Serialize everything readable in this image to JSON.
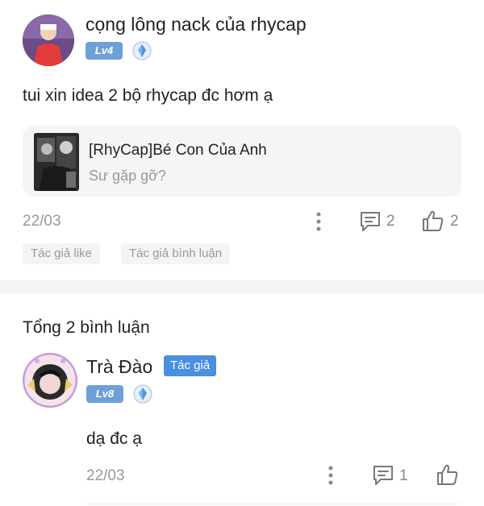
{
  "post": {
    "author": "cọng lông nack của rhycap",
    "level": "Lv4",
    "text": "tui xin idea 2 bộ rhycap đc hơm ạ",
    "quote": {
      "title": "[RhyCap]Bé Con Của Anh",
      "subtitle": "Sư gặp gỡ?"
    },
    "date": "22/03",
    "comment_count": "2",
    "like_count": "2",
    "tags": [
      "Tác giả like",
      "Tác giả bình luận"
    ]
  },
  "comments_section": {
    "title": "Tổng 2 bình luận"
  },
  "comment": {
    "author": "Trà Đào",
    "author_badge": "Tác giả",
    "level": "Lv8",
    "text": "dạ đc ạ",
    "date": "22/03",
    "reply_count": "1"
  },
  "colors": {
    "level_badge": "#6f9fd8",
    "author_badge": "#4a8fe0",
    "muted_text": "#999999"
  }
}
